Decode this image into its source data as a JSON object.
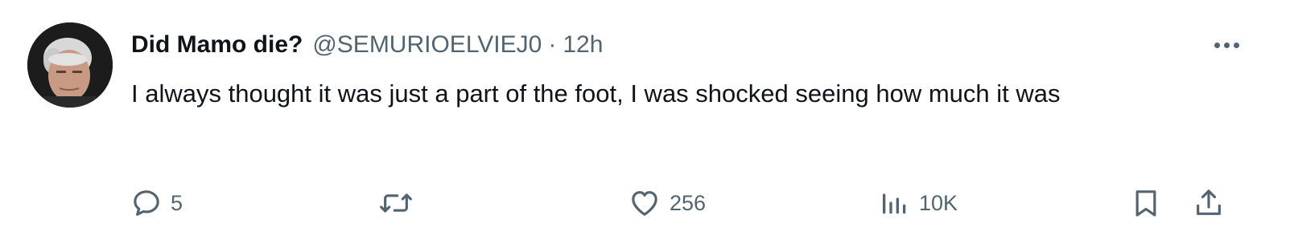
{
  "tweet": {
    "display_name": "Did Mamo die?",
    "handle": "@SEMURIOELVIEJ0",
    "separator": "·",
    "time": "12h",
    "text": "I always thought it was just a part of the foot, I was shocked seeing how much it was"
  },
  "actions": {
    "reply": {
      "icon": "reply-icon",
      "count": "5"
    },
    "retweet": {
      "icon": "retweet-icon",
      "count": ""
    },
    "like": {
      "icon": "heart-icon",
      "count": "256"
    },
    "views": {
      "icon": "views-icon",
      "count": "10K"
    },
    "bookmark": {
      "icon": "bookmark-icon"
    },
    "share": {
      "icon": "share-icon"
    }
  },
  "colors": {
    "text_primary": "#0f1419",
    "text_secondary": "#536471",
    "background": "#ffffff"
  }
}
